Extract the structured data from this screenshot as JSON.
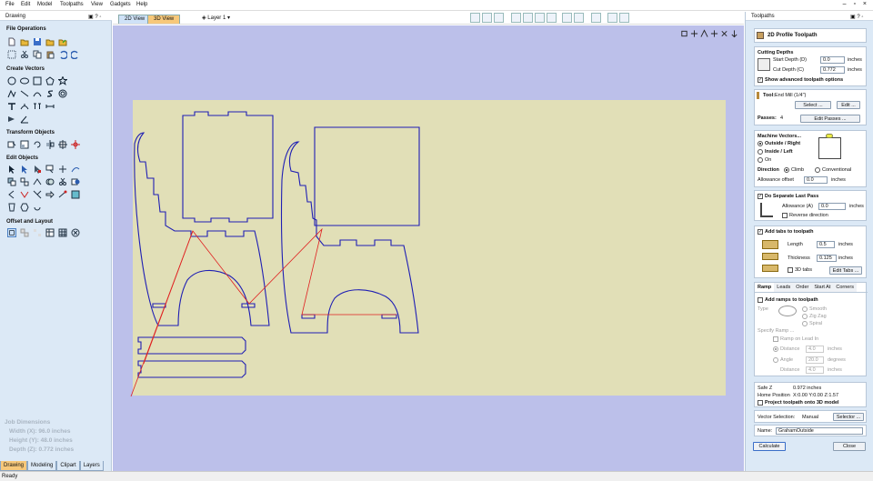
{
  "menu": [
    "File",
    "Edit",
    "Model",
    "Toolpaths",
    "View",
    "Gadgets",
    "Help"
  ],
  "left_panel": {
    "title": "Drawing",
    "pin": "▣ ? ◦",
    "sections": [
      {
        "label": "File Operations"
      },
      {
        "label": "Create Vectors"
      },
      {
        "label": "Transform Objects"
      },
      {
        "label": "Edit Objects"
      },
      {
        "label": "Offset and Layout"
      }
    ],
    "job_dimensions": {
      "title": "Job Dimensions",
      "width": "Width  (X): 96.0 inches",
      "height": "Height (Y): 48.0 inches",
      "depth": "Depth  (Z): 0.772 inches"
    },
    "tabs": [
      "Drawing",
      "Modeling",
      "Clipart",
      "Layers"
    ]
  },
  "view": {
    "tabs": [
      "2D View",
      "3D View"
    ],
    "active_tab": "3D View",
    "layer": "Layer 1"
  },
  "right_panel": {
    "title": "Toolpaths",
    "pin": "▣ ? ◦",
    "header": "2D Profile Toolpath",
    "cutting_depths": {
      "title": "Cutting Depths",
      "start_label": "Start Depth (D)",
      "start_value": "0.0",
      "start_unit": "inches",
      "cut_label": "Cut Depth (C)",
      "cut_value": "0.772",
      "cut_unit": "inches",
      "show_advanced": "Show advanced toolpath options"
    },
    "tool": {
      "label": "Tool:",
      "name": "End Mill (1/4\")",
      "select": "Select ...",
      "edit": "Edit ...",
      "passes_label": "Passes:",
      "passes_value": "4",
      "edit_passes": "Edit Passes ..."
    },
    "machine_vectors": {
      "title": "Machine Vectors...",
      "outside": "Outside / Right",
      "inside": "Inside / Left",
      "on": "On",
      "direction_label": "Direction",
      "climb": "Climb",
      "conventional": "Conventional",
      "allowance_label": "Allowance offset",
      "allowance_value": "0.0",
      "allowance_unit": "inches"
    },
    "last_pass": {
      "title": "Do Separate Last Pass",
      "allowance_label": "Allowance (A)",
      "allowance_value": "0.0",
      "allowance_unit": "inches",
      "reverse": "Reverse direction"
    },
    "tabs_section": {
      "title": "Add tabs to toolpath",
      "length_label": "Length",
      "length_value": "0.5",
      "length_unit": "inches",
      "thickness_label": "Thickness",
      "thickness_value": "0.125",
      "thickness_unit": "inches",
      "tabs3d": "3D tabs",
      "edit_tabs": "Edit Tabs ..."
    },
    "subtabs": [
      "Ramp",
      "Leads",
      "Order",
      "Start At",
      "Corners"
    ],
    "ramp": {
      "add": "Add ramps to toolpath",
      "type_label": "Type",
      "smooth": "Smooth",
      "zigzag": "Zig Zag",
      "spiral": "Spiral",
      "specify": "Specify Ramp ...",
      "lead_in": "Ramp on Lead In",
      "distance_label": "Distance",
      "distance_value": "4.0",
      "distance_unit": "inches",
      "angle_label": "Angle",
      "angle_value": "20.0",
      "angle_unit": "degrees",
      "distance2_label": "Distance",
      "distance2_value": "4.0",
      "distance2_unit": "inches"
    },
    "safe": {
      "safe_z": "Safe Z",
      "safe_z_value": "0.972 inches",
      "home": "Home Position",
      "home_value": "X:0.00 Y:0.00 Z:1.57",
      "project": "Project toolpath onto 3D model"
    },
    "vector_selection_label": "Vector Selection:",
    "vector_selection_value": "Manual",
    "selector": "Selector ...",
    "name_label": "Name:",
    "name_value": "GrahamOutside",
    "calculate": "Calculate",
    "close": "Close"
  },
  "status": "Ready",
  "colors": {
    "vector": "#1e1eb4",
    "toolpath_link": "#e02020",
    "board": "#e1dfb7",
    "canvas": "#bcc0ea",
    "panel": "#dce9f6",
    "active_tab": "#f7c87a"
  }
}
